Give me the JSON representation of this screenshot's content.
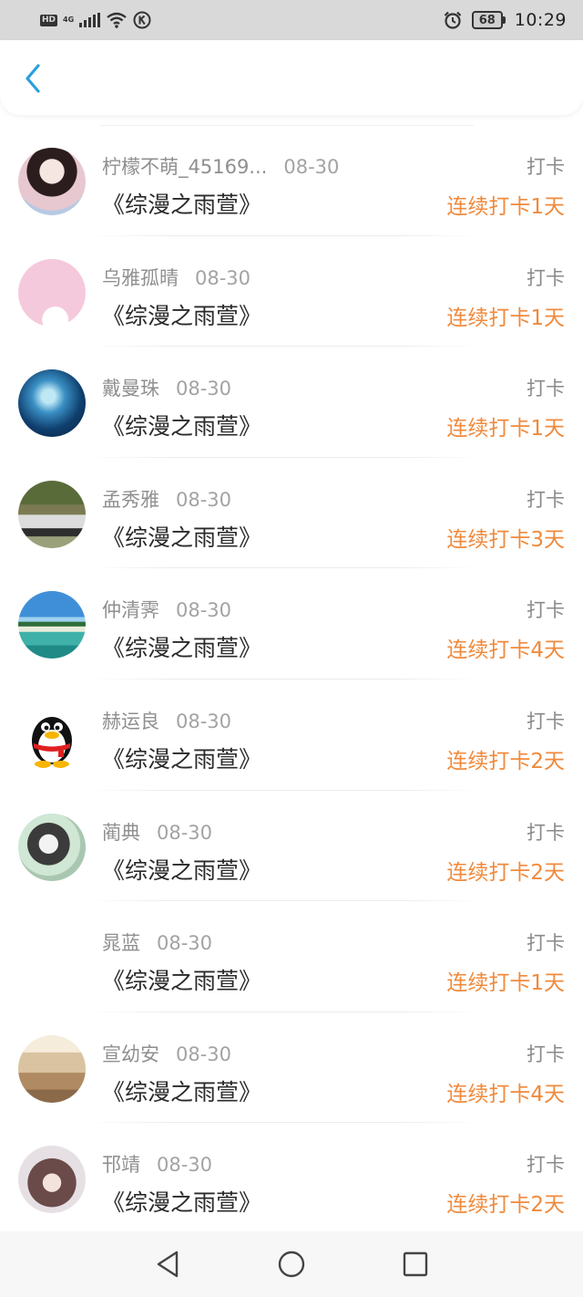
{
  "status_bar": {
    "hd": "HD",
    "network": "4G",
    "battery_level": "68",
    "time": "10:29",
    "icons": [
      "hd-icon",
      "signal-icon",
      "wifi-icon",
      "k-icon",
      "alarm-icon",
      "battery-icon"
    ]
  },
  "header": {
    "back_icon": "chevron-left-icon",
    "accent_color": "#2a9fe0"
  },
  "colors": {
    "streak": "#f08a3c",
    "meta": "#8f8f8f",
    "title": "#2a2a2a"
  },
  "rows": [
    {
      "name": "柠檬不萌_45169...",
      "date": "08-30",
      "title": "《综漫之雨萱》",
      "type": "打卡",
      "streak": "连续打卡1天",
      "avatar": "anime-girl-avatar"
    },
    {
      "name": "乌雅孤晴",
      "date": "08-30",
      "title": "《综漫之雨萱》",
      "type": "打卡",
      "streak": "连续打卡1天",
      "avatar": "pink-cartoon-avatar"
    },
    {
      "name": "戴曼珠",
      "date": "08-30",
      "title": "《综漫之雨萱》",
      "type": "打卡",
      "streak": "连续打卡1天",
      "avatar": "blue-fantasy-avatar"
    },
    {
      "name": "孟秀雅",
      "date": "08-30",
      "title": "《综漫之雨萱》",
      "type": "打卡",
      "streak": "连续打卡3天",
      "avatar": "vintage-car-avatar"
    },
    {
      "name": "仲清霁",
      "date": "08-30",
      "title": "《综漫之雨萱》",
      "type": "打卡",
      "streak": "连续打卡4天",
      "avatar": "beach-avatar"
    },
    {
      "name": "赫运良",
      "date": "08-30",
      "title": "《综漫之雨萱》",
      "type": "打卡",
      "streak": "连续打卡2天",
      "avatar": "qq-penguin-avatar"
    },
    {
      "name": "蔺典",
      "date": "08-30",
      "title": "《综漫之雨萱》",
      "type": "打卡",
      "streak": "连续打卡2天",
      "avatar": "sketch-girl-avatar"
    },
    {
      "name": "晁蓝",
      "date": "08-30",
      "title": "《综漫之雨萱》",
      "type": "打卡",
      "streak": "连续打卡1天",
      "avatar": "blank-avatar"
    },
    {
      "name": "宣幼安",
      "date": "08-30",
      "title": "《综漫之雨萱》",
      "type": "打卡",
      "streak": "连续打卡4天",
      "avatar": "swing-forest-avatar"
    },
    {
      "name": "邗靖",
      "date": "08-30",
      "title": "《综漫之雨萱》",
      "type": "打卡",
      "streak": "连续打卡2天",
      "avatar": "anime-boy-avatar"
    }
  ],
  "nav": {
    "icons": [
      "back-triangle-icon",
      "home-circle-icon",
      "recents-square-icon"
    ]
  }
}
